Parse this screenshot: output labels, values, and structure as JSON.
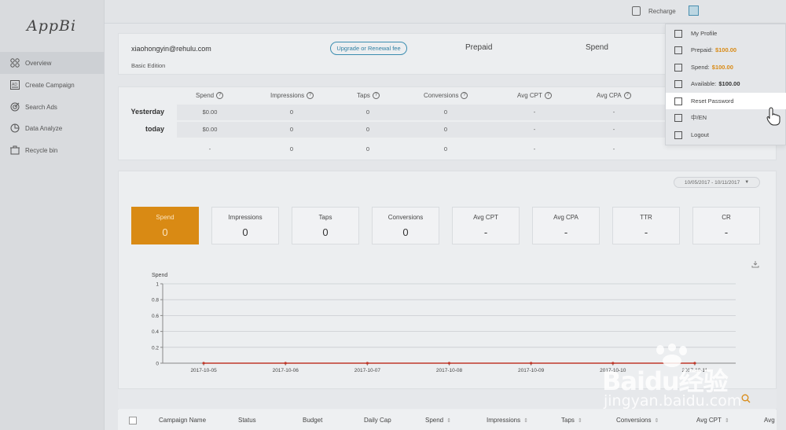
{
  "app": {
    "logo_text": "AppBi"
  },
  "sidebar": {
    "items": [
      {
        "label": "Overview",
        "icon": "grid-icon",
        "active": true
      },
      {
        "label": "Create Campaign",
        "icon": "ad-icon",
        "active": false
      },
      {
        "label": "Search Ads",
        "icon": "target-icon",
        "active": false
      },
      {
        "label": "Data Analyze",
        "icon": "chart-icon",
        "active": false
      },
      {
        "label": "Recycle bin",
        "icon": "recycle-icon",
        "active": false
      }
    ]
  },
  "topbar": {
    "recharge_label": "Recharge"
  },
  "account": {
    "email": "xiaohongyin@rehulu.com",
    "edition": "Basic Edition",
    "upgrade_label": "Upgrade or Renewal fee",
    "prepaid_label": "Prepaid",
    "spend_label": "Spend"
  },
  "stats": {
    "columns": [
      "Spend",
      "Impressions",
      "Taps",
      "Conversions",
      "Avg CPT",
      "Avg CPA"
    ],
    "rows": [
      {
        "label": "Yesterday",
        "values": [
          "$0.00",
          "0",
          "0",
          "0",
          "-",
          "-"
        ]
      },
      {
        "label": "today",
        "values": [
          "$0.00",
          "0",
          "0",
          "0",
          "-",
          "-"
        ]
      },
      {
        "label": "",
        "values": [
          "-",
          "0",
          "0",
          "0",
          "-",
          "-"
        ]
      }
    ]
  },
  "overview": {
    "date_range": "10/05/2017 - 10/11/2017",
    "metrics": [
      {
        "label": "Spend",
        "value": "0",
        "active": true
      },
      {
        "label": "Impressions",
        "value": "0",
        "active": false
      },
      {
        "label": "Taps",
        "value": "0",
        "active": false
      },
      {
        "label": "Conversions",
        "value": "0",
        "active": false
      },
      {
        "label": "Avg CPT",
        "value": "-",
        "active": false
      },
      {
        "label": "Avg CPA",
        "value": "-",
        "active": false
      },
      {
        "label": "TTR",
        "value": "-",
        "active": false
      },
      {
        "label": "CR",
        "value": "-",
        "active": false
      }
    ]
  },
  "chart_data": {
    "type": "line",
    "ylabel": "Spend",
    "x": [
      "2017-10-05",
      "2017-10-06",
      "2017-10-07",
      "2017-10-08",
      "2017-10-09",
      "2017-10-10",
      "2017-10-11"
    ],
    "yticks": [
      "0",
      "0.2",
      "0.4",
      "0.6",
      "0.8",
      "1"
    ],
    "ylim": [
      0,
      1
    ],
    "series": [
      {
        "values": [
          0,
          0,
          0,
          0,
          0,
          0,
          0
        ],
        "color": "#c0392b"
      }
    ],
    "grid": true
  },
  "table": {
    "headers": [
      "Campaign Name",
      "Status",
      "Budget",
      "Daily Cap",
      "Spend",
      "Impressions",
      "Taps",
      "Conversions",
      "Avg CPT",
      "Avg"
    ]
  },
  "dropdown": {
    "items": [
      {
        "label": "My Profile",
        "icon": "profile-icon"
      },
      {
        "label": "Prepaid:",
        "value": "$100.00",
        "value_style": "orange",
        "icon": "wallet-icon"
      },
      {
        "label": "Spend:",
        "value": "$100.00",
        "value_style": "orange",
        "icon": "card-icon"
      },
      {
        "label": "Available:",
        "value": "$100.00",
        "value_style": "bold",
        "icon": "balance-icon"
      },
      {
        "label": "Reset Password",
        "icon": "key-icon",
        "hover": true
      },
      {
        "label": "中/EN",
        "icon": "language-icon"
      },
      {
        "label": "Logout",
        "icon": "logout-icon"
      }
    ]
  },
  "watermark": {
    "brand": "Baidu经验",
    "url": "jingyan.baidu.com"
  },
  "colors": {
    "accent": "#d98a14",
    "link": "#2f7fa3",
    "line": "#c0392b"
  }
}
